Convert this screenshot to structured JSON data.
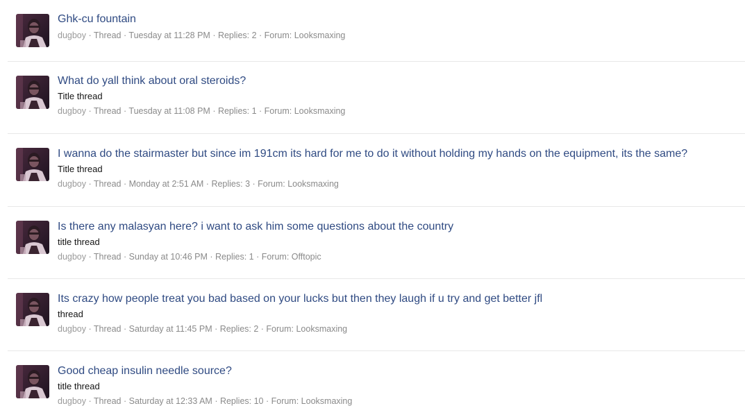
{
  "results": [
    {
      "title": "Ghk-cu fountain",
      "snippet": "",
      "username": "dugboy",
      "type": "Thread",
      "date": "Tuesday at 11:28 PM",
      "replies": "Replies: 2",
      "forum_prefix": "Forum: ",
      "forum": "Looksmaxing"
    },
    {
      "title": "What do yall think about oral steroids?",
      "snippet": "Title thread",
      "username": "dugboy",
      "type": "Thread",
      "date": "Tuesday at 11:08 PM",
      "replies": "Replies: 1",
      "forum_prefix": "Forum: ",
      "forum": "Looksmaxing"
    },
    {
      "title": "I wanna do the stairmaster but since im 191cm its hard for me to do it without holding my hands on the equipment, its the same?",
      "snippet": "Title thread",
      "username": "dugboy",
      "type": "Thread",
      "date": "Monday at 2:51 AM",
      "replies": "Replies: 3",
      "forum_prefix": "Forum: ",
      "forum": "Looksmaxing"
    },
    {
      "title": "Is there any malasyan here? i want to ask him some questions about the country",
      "snippet": "title thread",
      "username": "dugboy",
      "type": "Thread",
      "date": "Sunday at 10:46 PM",
      "replies": "Replies: 1",
      "forum_prefix": "Forum: ",
      "forum": "Offtopic"
    },
    {
      "title": "Its crazy how people treat you bad based on your lucks but then they laugh if u try and get better jfl",
      "snippet": "thread",
      "username": "dugboy",
      "type": "Thread",
      "date": "Saturday at 11:45 PM",
      "replies": "Replies: 2",
      "forum_prefix": "Forum: ",
      "forum": "Looksmaxing"
    },
    {
      "title": "Good cheap insulin needle source?",
      "snippet": "title thread",
      "username": "dugboy",
      "type": "Thread",
      "date": "Saturday at 12:33 AM",
      "replies": "Replies: 10",
      "forum_prefix": "Forum: ",
      "forum": "Looksmaxing"
    }
  ],
  "separator": " · ",
  "colors": {
    "title": "#2f4a82",
    "meta": "#8a8a8a",
    "snippet": "#141414",
    "divider": "#e8e8e8"
  },
  "icons": {
    "avatar": "user-avatar-photo"
  }
}
